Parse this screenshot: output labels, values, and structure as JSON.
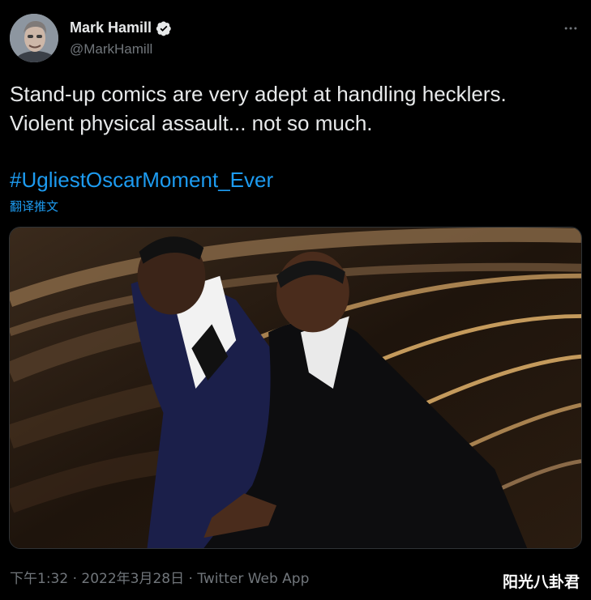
{
  "author": {
    "display_name": "Mark Hamill",
    "handle": "@MarkHamill",
    "verified": true
  },
  "tweet": {
    "text": "Stand-up comics are very adept at handling hecklers.\nViolent physical assault... not so much.",
    "hashtag": "#UgliestOscarMoment_Ever",
    "translate_label": "翻译推文"
  },
  "meta": {
    "timestamp": "下午1:32 · 2022年3月28日",
    "separator": " · ",
    "source": "Twitter Web App"
  },
  "watermark": "阳光八卦君",
  "icons": {
    "verified": "verified-badge-icon",
    "more": "more-options-icon"
  },
  "colors": {
    "background": "#000000",
    "text": "#e7e9ea",
    "secondary": "#71767b",
    "link": "#1d9bf0"
  }
}
